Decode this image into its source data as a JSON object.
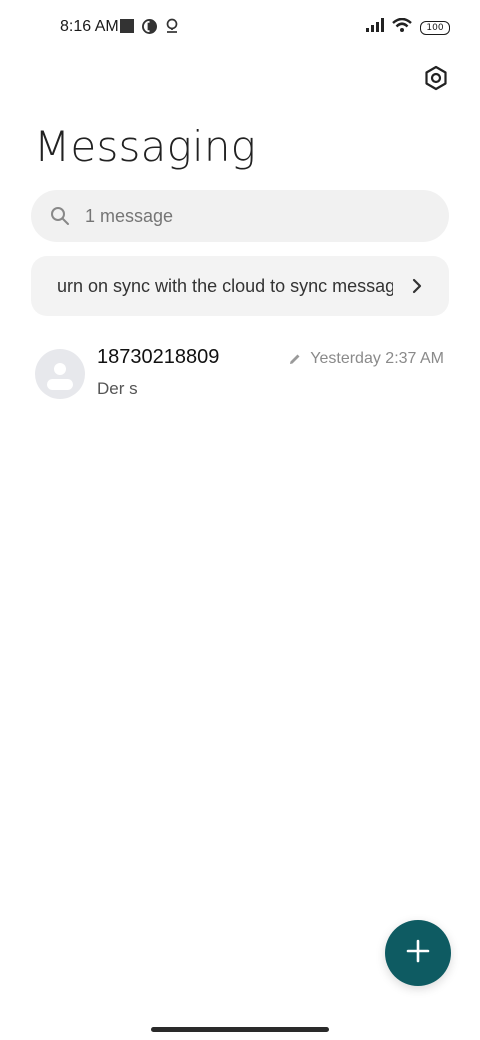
{
  "status_bar": {
    "time": "8:16 AM",
    "battery": "100",
    "left_icons": [
      "square-notification-icon",
      "data-saver-icon",
      "location-pin-icon"
    ],
    "right_icons": [
      "signal-icon",
      "wifi-icon",
      "battery-icon"
    ]
  },
  "header": {
    "title": "Messaging",
    "settings_icon": "settings-icon"
  },
  "search": {
    "placeholder": "1 message",
    "icon": "search-icon"
  },
  "sync_banner": {
    "text": "urn on sync with the cloud to sync messag",
    "icon": "chevron-right-icon"
  },
  "conversations": [
    {
      "name": "18730218809",
      "preview": "Der s",
      "time": "Yesterday 2:37 AM",
      "draft_icon": "pencil-icon"
    }
  ],
  "fab": {
    "icon": "plus-icon",
    "color": "#0e5b62"
  }
}
